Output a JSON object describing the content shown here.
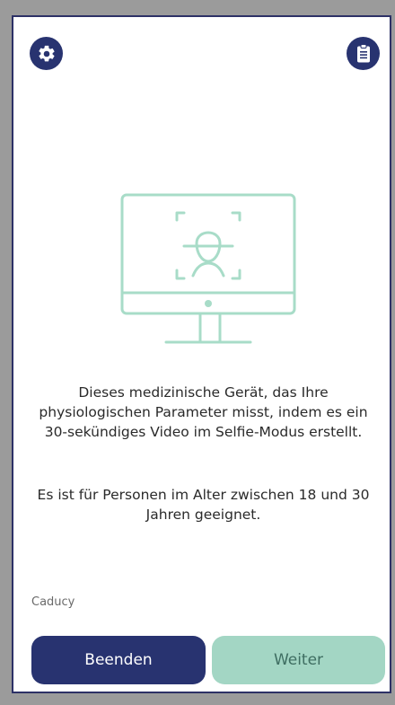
{
  "header": {
    "settings_icon": "gear-icon",
    "report_icon": "clipboard-icon",
    "accent": "#283370"
  },
  "illustration": {
    "name": "monitor-face-scan-icon",
    "color": "#a8dcc8"
  },
  "content": {
    "paragraph1": "Dieses medizinische Gerät, das Ihre physiologischen Parameter misst, indem es ein 30-sekündiges Video im Selfie-Modus erstellt.",
    "paragraph2": "Es ist für Personen im Alter zwischen 18 und 30 Jahren geeignet."
  },
  "footer": {
    "brand": "Caducy",
    "finish_label": "Beenden",
    "next_label": "Weiter",
    "finish_color": "#283370",
    "next_color": "#a3d6c4"
  }
}
